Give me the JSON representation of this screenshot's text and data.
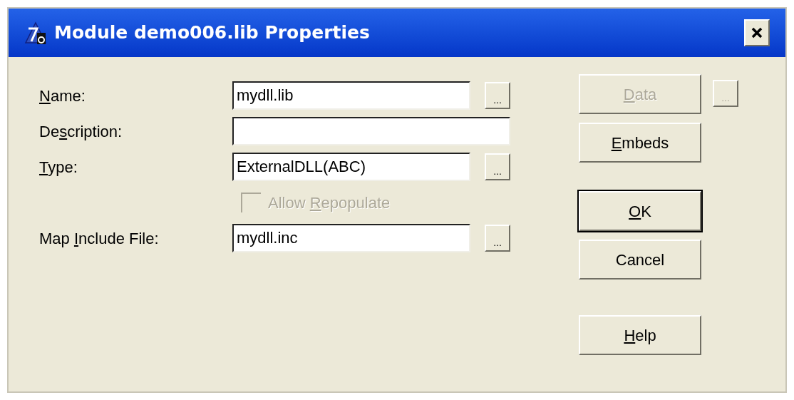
{
  "window": {
    "title": "Module demo006.lib Properties"
  },
  "fields": [
    {
      "label": {
        "key": "N",
        "after": "ame:"
      },
      "value": "mydll.lib",
      "browse": "..."
    },
    {
      "label": {
        "before": "De",
        "key": "s",
        "after": "cription:"
      }
    },
    {
      "label": {
        "key": "T",
        "after": "ype:"
      },
      "value": "ExternalDLL(ABC)",
      "browse": "..."
    },
    {
      "kind": "checkbox",
      "label": {
        "before": "Allow ",
        "key": "R",
        "after": "epopulate"
      },
      "checked": false,
      "disabled": true
    },
    {
      "label": {
        "before": "Map ",
        "key": "I",
        "after": "nclude File:"
      },
      "value": "mydll.inc",
      "browse": "..."
    }
  ],
  "button_groups": [
    [
      {
        "label": {
          "key": "D",
          "after": "ata"
        },
        "disabled": true,
        "default": false,
        "browse": {
          "label": "...",
          "disabled": true
        }
      },
      {
        "label": {
          "key": "E",
          "after": "mbeds"
        },
        "disabled": false,
        "default": false
      }
    ],
    [
      {
        "label": {
          "key": "O",
          "after": "K"
        },
        "disabled": false,
        "default": true
      },
      {
        "label": {
          "before": "Cancel"
        },
        "disabled": false,
        "default": false
      }
    ],
    [
      {
        "label": {
          "key": "H",
          "after": "elp"
        },
        "disabled": false,
        "default": false
      }
    ]
  ]
}
